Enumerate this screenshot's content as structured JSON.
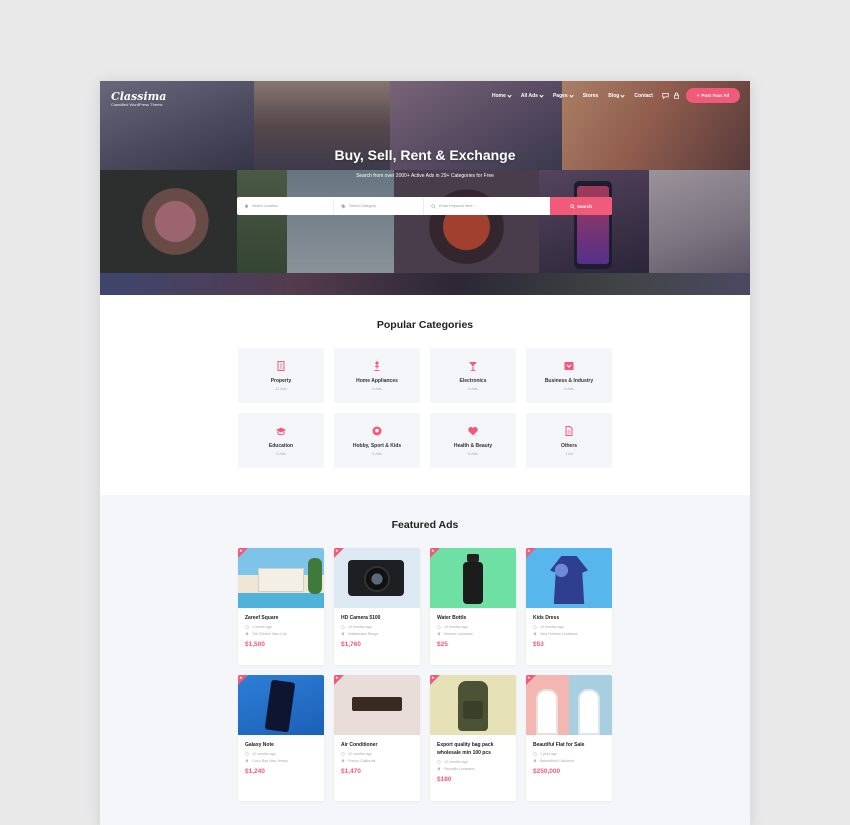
{
  "brand": {
    "logo": "Classima",
    "tagline": "Classified WordPress Theme"
  },
  "nav": {
    "items": [
      "Home",
      "All Ads",
      "Pages",
      "Stores",
      "Blog",
      "Contact"
    ],
    "post_button": "Post Your Ad"
  },
  "hero": {
    "title": "Buy, Sell, Rent & Exchange",
    "subtitle": "Search from over 2000+ Active Ads in 29+ Categories for Free"
  },
  "search": {
    "location_placeholder": "Select Location",
    "category_placeholder": "Select Category",
    "keyword_placeholder": "Enter Keyword here ...",
    "button": "Search"
  },
  "categories": {
    "title": "Popular Categories",
    "items": [
      {
        "name": "Property",
        "count": "11 Ads",
        "icon": "building-icon"
      },
      {
        "name": "Home Appliances",
        "count": "4 Ads",
        "icon": "lamp-icon"
      },
      {
        "name": "Electronics",
        "count": "4 Ads",
        "icon": "antenna-icon"
      },
      {
        "name": "Business & Industry",
        "count": "4 Ads",
        "icon": "briefcase-icon"
      },
      {
        "name": "Education",
        "count": "3 Ads",
        "icon": "graduation-cap-icon"
      },
      {
        "name": "Hobby, Sport & Kids",
        "count": "4 Ads",
        "icon": "soccer-ball-icon"
      },
      {
        "name": "Health & Beauty",
        "count": "6 Ads",
        "icon": "heart-icon"
      },
      {
        "name": "Others",
        "count": "1 Ad",
        "icon": "document-icon"
      }
    ]
  },
  "featured": {
    "title": "Featured Ads",
    "ads": [
      {
        "title": "Zareef Square",
        "time": "1 month ago",
        "location": "Toh Chheile New Cok",
        "price": "$1,500",
        "image": "house-pool"
      },
      {
        "title": "HD Camera 5100",
        "time": "10 months ago",
        "location": "Hollabinans Range",
        "price": "$1,760",
        "image": "camera"
      },
      {
        "title": "Water Bottle",
        "time": "10 months ago",
        "location": "Monroe Louisiana",
        "price": "$25",
        "image": "bottle"
      },
      {
        "title": "Kids Dress",
        "time": "10 months ago",
        "location": "New Orleans Louisiana",
        "price": "$53",
        "image": "dress"
      },
      {
        "title": "Galaxy Note",
        "time": "10 months ago",
        "location": "Cox's Bay New Jersey",
        "price": "$1,240",
        "image": "phone"
      },
      {
        "title": "Air Conditioner",
        "time": "10 months ago",
        "location": "Fresno California",
        "price": "$1,470",
        "image": "ac"
      },
      {
        "title": "Export quality bag pack wholesale min 100 pcs",
        "time": "10 months ago",
        "location": "Republic Louisiana",
        "price": "$180",
        "image": "backpack"
      },
      {
        "title": "Beautiful Flat for Sale",
        "time": "1 year ago",
        "location": "Bakersfield California",
        "price": "$250,000",
        "image": "flat"
      }
    ]
  },
  "colors": {
    "accent": "#f15a78",
    "section_bg": "#f4f6f9",
    "card_bg": "#f3f5f8"
  }
}
